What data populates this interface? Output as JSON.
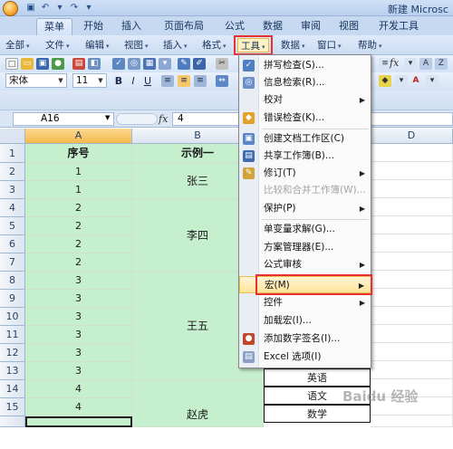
{
  "window": {
    "title": "新建 Microsc"
  },
  "ribbon": {
    "tabs": [
      "菜单",
      "开始",
      "插入",
      "页面布局",
      "公式",
      "数据",
      "审阅",
      "视图",
      "开发工具"
    ]
  },
  "menubar": {
    "items": [
      "全部",
      "文件",
      "编辑",
      "视图",
      "插入",
      "格式",
      "工具",
      "数据",
      "窗口",
      "帮助"
    ]
  },
  "toolbar": {
    "font_name": "宋体",
    "font_size": "11",
    "fx_symbol": "fx"
  },
  "formula_bar": {
    "name_box": "A16",
    "fx_symbol": "fx",
    "content": "4"
  },
  "sheet": {
    "columns": [
      "A",
      "B",
      "C",
      "D"
    ],
    "rows": [
      "1",
      "2",
      "3",
      "4",
      "5",
      "6",
      "7",
      "8",
      "9",
      "10",
      "11",
      "12",
      "13",
      "14",
      "15"
    ],
    "header_a": "序号",
    "header_b": "示例一",
    "col_a_values": [
      "1",
      "1",
      "2",
      "2",
      "2",
      "2",
      "3",
      "3",
      "3",
      "3",
      "3",
      "3",
      "4",
      "4"
    ],
    "merged_b": [
      "张三",
      "李四",
      "王五",
      "赵虎"
    ],
    "col_c_values": [
      "英语",
      "语文",
      "数学"
    ]
  },
  "tools_menu": {
    "items": [
      {
        "label": "拼写检查(S)...",
        "icon": "spellcheck-icon"
      },
      {
        "label": "信息检索(R)...",
        "icon": "research-icon"
      },
      {
        "label": "校对",
        "submenu": true
      },
      {
        "label": "错误检查(K)...",
        "icon": "error-check-icon"
      },
      {
        "label": "创建文档工作区(C)",
        "icon": "workspace-icon"
      },
      {
        "label": "共享工作簿(B)...",
        "icon": "share-workbook-icon"
      },
      {
        "label": "修订(T)",
        "icon": "track-changes-icon",
        "submenu": true
      },
      {
        "label": "比较和合并工作簿(W)...",
        "disabled": true
      },
      {
        "label": "保护(P)",
        "submenu": true
      },
      {
        "label": "单变量求解(G)..."
      },
      {
        "label": "方案管理器(E)..."
      },
      {
        "label": "公式审核",
        "submenu": true
      },
      {
        "label": "宏(M)",
        "submenu": true,
        "highlighted": true
      },
      {
        "label": "控件",
        "submenu": true
      },
      {
        "label": "加载宏(I)..."
      },
      {
        "label": "添加数字签名(I)...",
        "icon": "digital-signature-icon"
      },
      {
        "label": "Excel 选项(I)",
        "icon": "excel-options-icon"
      }
    ]
  },
  "watermark": "Baidu 经验",
  "colors": {
    "green_fill": "#c6efce",
    "highlight_border": "#e8312f"
  }
}
